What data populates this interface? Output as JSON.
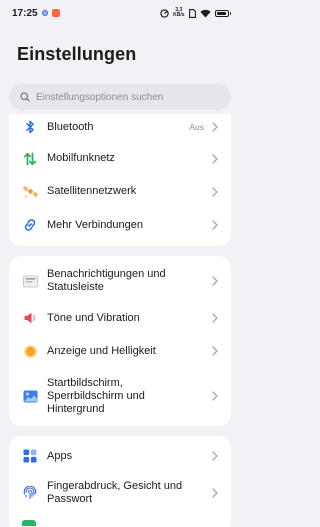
{
  "status_bar": {
    "time": "17:25",
    "speed_value": "3,3",
    "speed_unit": "KB/s",
    "battery_level": 0.95
  },
  "page": {
    "title": "Einstellungen"
  },
  "search": {
    "placeholder": "Einstellungsoptionen suchen"
  },
  "connectivity": {
    "items": [
      {
        "label": "Bluetooth",
        "value": "Aus",
        "icon": "bluetooth-icon"
      },
      {
        "label": "Mobilfunknetz",
        "icon": "mobile-network-icon"
      },
      {
        "label": "Satellitennetzwerk",
        "icon": "satellite-icon"
      },
      {
        "label": "Mehr Verbindungen",
        "icon": "link-icon"
      }
    ]
  },
  "display": {
    "items": [
      {
        "label_lines": [
          "Benachrichtigungen und",
          "Statusleiste"
        ],
        "icon": "notifications-icon"
      },
      {
        "label": "Töne und Vibration",
        "icon": "sound-icon"
      },
      {
        "label": "Anzeige und Helligkeit",
        "icon": "brightness-icon"
      },
      {
        "label_lines": [
          "Startbildschirm,",
          "Sperrbildschirm und",
          "Hintergrund"
        ],
        "icon": "wallpaper-icon"
      }
    ]
  },
  "apps": {
    "items": [
      {
        "label": "Apps",
        "icon": "apps-icon"
      },
      {
        "label_lines": [
          "Fingerabdruck, Gesicht und",
          "Passwort"
        ],
        "icon": "fingerprint-icon"
      }
    ]
  },
  "colors": {
    "background": "#f2f2f6",
    "card": "#ffffff",
    "bluetooth_blue": "#2f6fe4",
    "mobile_green": "#2cb463",
    "satellite_orange": "#f29b38",
    "link_blue": "#2f6fe4",
    "sound_red": "#e8474f",
    "brightness_orange": "#f7a51c",
    "apps_blue": "#2f6fe4",
    "fingerprint_blue": "#3d63d8"
  }
}
